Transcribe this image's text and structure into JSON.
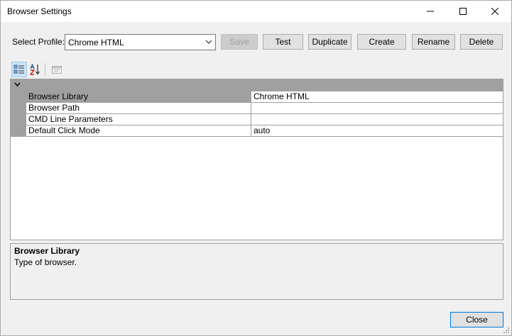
{
  "window": {
    "title": "Browser Settings"
  },
  "profile": {
    "label": "Select Profile:",
    "selected": "Chrome HTML"
  },
  "buttons": {
    "save": "Save",
    "test": "Test",
    "duplicate": "Duplicate",
    "create": "Create",
    "rename": "Rename",
    "delete": "Delete",
    "close": "Close"
  },
  "toolbar": {
    "icons": [
      "categorized-icon",
      "alphabetical-icon",
      "property-pages-icon"
    ]
  },
  "properties": [
    {
      "name": "Browser Library",
      "value": "Chrome HTML"
    },
    {
      "name": "Browser Path",
      "value": ""
    },
    {
      "name": "CMD Line Parameters",
      "value": ""
    },
    {
      "name": "Default Click Mode",
      "value": "auto"
    }
  ],
  "description": {
    "title": "Browser Library",
    "text": "Type of browser."
  },
  "colors": {
    "accent": "#0078d7",
    "grid_gray": "#a0a0a0"
  }
}
